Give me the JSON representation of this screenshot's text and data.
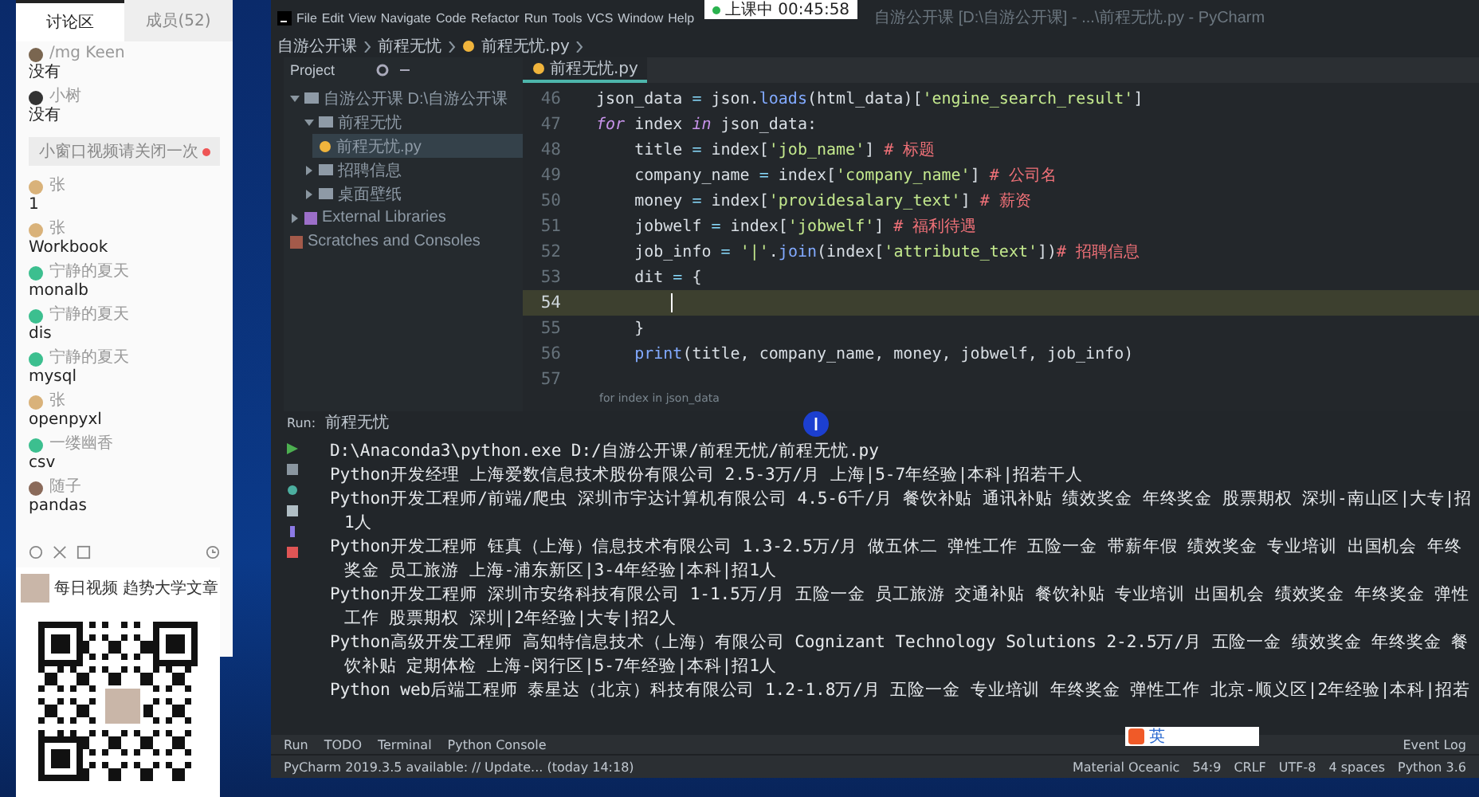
{
  "chat_window": {
    "tabs": [
      {
        "label": "讨论区",
        "selected": true
      },
      {
        "label": "成员(52)",
        "selected": false
      }
    ],
    "messages": [
      {
        "kind": "message",
        "name": "/mg Keen",
        "text": "没有",
        "color": "#7a6650"
      },
      {
        "kind": "message",
        "name": "小树",
        "text": "没有",
        "color": "#333333"
      },
      {
        "kind": "notice",
        "text": "小窗口视频请关闭一次"
      },
      {
        "kind": "message",
        "name": "张",
        "text": "1",
        "color": "#d9b27a"
      },
      {
        "kind": "message",
        "name": "张",
        "text": "Workbook",
        "color": "#d9b27a"
      },
      {
        "kind": "message",
        "name": "宁静的夏天",
        "text": "monalb",
        "color": "#3cbf8f"
      },
      {
        "kind": "message",
        "name": "宁静的夏天",
        "text": "dis",
        "color": "#3cbf8f"
      },
      {
        "kind": "message",
        "name": "宁静的夏天",
        "text": "mysql",
        "color": "#3cbf8f"
      },
      {
        "kind": "message",
        "name": "张",
        "text": "openpyxl",
        "color": "#d9b27a"
      },
      {
        "kind": "message",
        "name": "一缕幽香",
        "text": "csv",
        "color": "#3cbf8f"
      },
      {
        "kind": "message",
        "name": "随子",
        "text": "pandas",
        "color": "#8a6a5a"
      }
    ]
  },
  "qr_card": {
    "caption": "每日视频 趋势大学文章"
  },
  "timer": {
    "label": "上课中 00:45:58"
  },
  "ide": {
    "menu": [
      "File",
      "Edit",
      "View",
      "Navigate",
      "Code",
      "Refactor",
      "Run",
      "Tools",
      "VCS",
      "Window",
      "Help"
    ],
    "title": "自游公开课 [D:\\自游公开课] - ...\\前程无忧.py - PyCharm",
    "breadcrumb": [
      "自游公开课",
      "前程无忧",
      "前程无忧.py"
    ],
    "project_label": "Project",
    "tree": [
      {
        "label": "自游公开课 D:\\自游公开课",
        "kind": "folder",
        "expanded": true,
        "selected": false,
        "children": [
          {
            "label": "前程无忧",
            "kind": "folder",
            "expanded": true,
            "selected": false,
            "children": [
              {
                "label": "前程无忧.py",
                "kind": "file",
                "selected": true
              }
            ]
          },
          {
            "label": "招聘信息",
            "kind": "folder",
            "expanded": false,
            "selected": false
          },
          {
            "label": "桌面壁纸",
            "kind": "folder",
            "expanded": false,
            "selected": false
          }
        ]
      },
      {
        "label": "External Libraries",
        "kind": "library",
        "expanded": false,
        "selected": false
      },
      {
        "label": "Scratches and Consoles",
        "kind": "scratch",
        "selected": false
      }
    ],
    "editor_tab": "前程无忧.py",
    "code_lines": [
      {
        "number": "46",
        "current": false,
        "tokens": [
          {
            "kind": "plain",
            "text": "json_data "
          },
          {
            "kind": "op",
            "text": "= "
          },
          {
            "kind": "plain",
            "text": "json."
          },
          {
            "kind": "fn",
            "text": "loads"
          },
          {
            "kind": "plain",
            "text": "(html_data)["
          },
          {
            "kind": "str",
            "text": "'engine_search_result'"
          },
          {
            "kind": "plain",
            "text": "]"
          }
        ]
      },
      {
        "number": "47",
        "current": false,
        "tokens": [
          {
            "kind": "kw",
            "text": "for"
          },
          {
            "kind": "plain",
            "text": " index "
          },
          {
            "kind": "kw",
            "text": "in"
          },
          {
            "kind": "plain",
            "text": " json_data:"
          }
        ]
      },
      {
        "number": "48",
        "current": false,
        "tokens": [
          {
            "kind": "plain",
            "text": "    title "
          },
          {
            "kind": "op",
            "text": "= "
          },
          {
            "kind": "plain",
            "text": "index["
          },
          {
            "kind": "str",
            "text": "'job_name'"
          },
          {
            "kind": "plain",
            "text": "] "
          },
          {
            "kind": "cmt",
            "text": "# 标题"
          }
        ]
      },
      {
        "number": "49",
        "current": false,
        "tokens": [
          {
            "kind": "plain",
            "text": "    company_name "
          },
          {
            "kind": "op",
            "text": "= "
          },
          {
            "kind": "plain",
            "text": "index["
          },
          {
            "kind": "str",
            "text": "'company_name'"
          },
          {
            "kind": "plain",
            "text": "] "
          },
          {
            "kind": "cmt",
            "text": "# 公司名"
          }
        ]
      },
      {
        "number": "50",
        "current": false,
        "tokens": [
          {
            "kind": "plain",
            "text": "    money "
          },
          {
            "kind": "op",
            "text": "= "
          },
          {
            "kind": "plain",
            "text": "index["
          },
          {
            "kind": "str",
            "text": "'providesalary_text'"
          },
          {
            "kind": "plain",
            "text": "] "
          },
          {
            "kind": "cmt",
            "text": "# 薪资"
          }
        ]
      },
      {
        "number": "51",
        "current": false,
        "tokens": [
          {
            "kind": "plain",
            "text": "    jobwelf "
          },
          {
            "kind": "op",
            "text": "= "
          },
          {
            "kind": "plain",
            "text": "index["
          },
          {
            "kind": "str",
            "text": "'jobwelf'"
          },
          {
            "kind": "plain",
            "text": "] "
          },
          {
            "kind": "cmt",
            "text": "# 福利待遇"
          }
        ]
      },
      {
        "number": "52",
        "current": false,
        "tokens": [
          {
            "kind": "plain",
            "text": "    job_info "
          },
          {
            "kind": "op",
            "text": "= "
          },
          {
            "kind": "str",
            "text": "'|'"
          },
          {
            "kind": "plain",
            "text": "."
          },
          {
            "kind": "fn",
            "text": "join"
          },
          {
            "kind": "plain",
            "text": "(index["
          },
          {
            "kind": "str",
            "text": "'attribute_text'"
          },
          {
            "kind": "plain",
            "text": "])"
          },
          {
            "kind": "cmt",
            "text": "# 招聘信息"
          }
        ]
      },
      {
        "number": "53",
        "current": false,
        "tokens": [
          {
            "kind": "plain",
            "text": "    dit "
          },
          {
            "kind": "op",
            "text": "= "
          },
          {
            "kind": "plain",
            "text": "{"
          }
        ]
      },
      {
        "number": "54",
        "current": true
      },
      {
        "number": "55",
        "current": false,
        "tokens": [
          {
            "kind": "plain",
            "text": "    }"
          }
        ]
      },
      {
        "number": "56",
        "current": false,
        "tokens": [
          {
            "kind": "fn",
            "text": "    print"
          },
          {
            "kind": "plain",
            "text": "(title, company_name, money, jobwelf, job_info)"
          }
        ]
      },
      {
        "number": "57",
        "current": false
      }
    ],
    "code_breadcrumb": "for index in json_data",
    "run_label": "Run:",
    "run_tab": "前程无忧",
    "console_lines": [
      "D:\\Anaconda3\\python.exe D:/自游公开课/前程无忧/前程无忧.py",
      "Python开发经理 上海爱数信息技术股份有限公司 2.5-3万/月  上海|5-7年经验|本科|招若干人",
      "Python开发工程师/前端/爬虫 深圳市宇达计算机有限公司 4.5-6千/月 餐饮补贴 通讯补贴 绩效奖金 年终奖金 股票期权 深圳-南山区|大专|招1人",
      "Python开发工程师 钰真（上海）信息技术有限公司 1.3-2.5万/月 做五休二 弹性工作 五险一金 带薪年假 绩效奖金 专业培训 出国机会 年终奖金 员工旅游 上海-浦东新区|3-4年经验|本科|招1人",
      "Python开发工程师 深圳市安络科技有限公司 1-1.5万/月 五险一金 员工旅游 交通补贴 餐饮补贴 专业培训 出国机会 绩效奖金 年终奖金 弹性工作 股票期权 深圳|2年经验|大专|招2人",
      "Python高级开发工程师 高知特信息技术（上海）有限公司 Cognizant Technology Solutions 2-2.5万/月 五险一金 绩效奖金 年终奖金 餐饮补贴 定期体检 上海-闵行区|5-7年经验|本科|招1人",
      "Python web后端工程师 泰星达（北京）科技有限公司 1.2-1.8万/月 五险一金 专业培训 年终奖金 弹性工作 北京-顺义区|2年经验|本科|招若"
    ],
    "tool_tabs": [
      "Run",
      "TODO",
      "Terminal",
      "Python Console"
    ],
    "event_log": "Event Log",
    "ime_label": "英",
    "status_message": "PyCharm 2019.3.5 available: // Update... (today 14:18)",
    "status_items": [
      "Material Oceanic",
      "54:9",
      "CRLF",
      "UTF-8",
      "4 spaces",
      "Python 3.6"
    ]
  }
}
